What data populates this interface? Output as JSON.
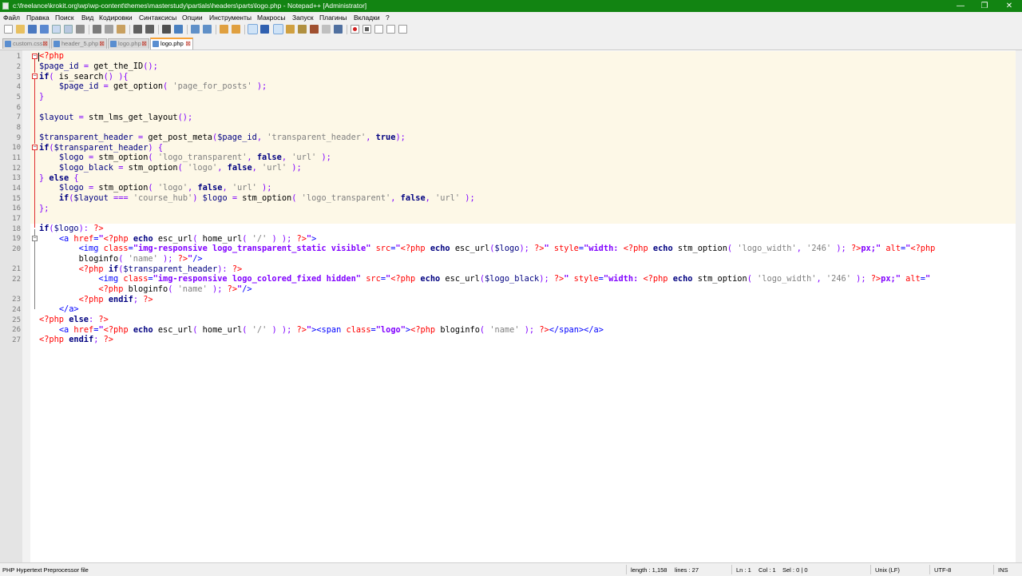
{
  "window": {
    "title": "c:\\freelance\\krokit.org\\wp\\wp-content\\themes\\masterstudy\\partials\\headers\\parts\\logo.php - Notepad++ [Administrator]",
    "minimize": "—",
    "maximize": "❐",
    "close": "✕"
  },
  "menu": [
    "Файл",
    "Правка",
    "Поиск",
    "Вид",
    "Кодировки",
    "Синтаксисы",
    "Опции",
    "Инструменты",
    "Макросы",
    "Запуск",
    "Плагины",
    "Вкладки",
    "?"
  ],
  "toolbar": [
    "new",
    "open",
    "save",
    "save-all",
    "close",
    "close-all",
    "print",
    "cut",
    "copy",
    "paste",
    "undo",
    "redo",
    "find",
    "replace",
    "zoom-in",
    "zoom-out",
    "sync-vertical",
    "sync-horizontal",
    "word-wrap",
    "show-all-chars",
    "indent-guide",
    "udl",
    "doc-map",
    "function-list",
    "folder-workspace",
    "monitor",
    "record-macro",
    "stop-record",
    "play-macro",
    "run-macro-multiple",
    "save-macro"
  ],
  "tabs": [
    {
      "label": "custom.css",
      "active": false
    },
    {
      "label": "header_5.php",
      "active": false
    },
    {
      "label": "logo.php",
      "active": false
    },
    {
      "label": "logo.php",
      "active": true
    }
  ],
  "code_lines": [
    "<?php",
    "$page_id = get_the_ID();",
    "if( is_search() ){",
    "    $page_id = get_option( 'page_for_posts' );",
    "}",
    "",
    "$layout = stm_lms_get_layout();",
    "",
    "$transparent_header = get_post_meta($page_id, 'transparent_header', true);",
    "if($transparent_header) {",
    "    $logo = stm_option( 'logo_transparent', false, 'url' );",
    "    $logo_black = stm_option( 'logo', false, 'url' );",
    "} else {",
    "    $logo = stm_option( 'logo', false, 'url' );",
    "    if($layout === 'course_hub') $logo = stm_option( 'logo_transparent', false, 'url' );",
    "};",
    "",
    "if($logo): ?>",
    "    <a href=\"<?php echo esc_url( home_url( '/' ) ); ?>\">",
    "        <img class=\"img-responsive logo_transparent_static visible\" src=\"<?php echo esc_url($logo); ?>\" style=\"width: <?php echo stm_option( 'logo_width', '246' ); ?>px;\" alt=\"<?php",
    "        bloginfo( 'name' ); ?>\"/>",
    "        <?php if($transparent_header): ?>",
    "            <img class=\"img-responsive logo_colored_fixed hidden\" src=\"<?php echo esc_url($logo_black); ?>\" style=\"width: <?php echo stm_option( 'logo_width', '246' ); ?>px;\" alt=\"",
    "            <?php bloginfo( 'name' ); ?>\"/>",
    "        <?php endif; ?>",
    "    </a>",
    "<?php else: ?>",
    "    <a href=\"<?php echo esc_url( home_url( '/' ) ); ?>\"><span class=\"logo\"><?php bloginfo( 'name' ); ?></span></a>",
    "<?php endif; ?>"
  ],
  "line_numbers": [
    "1",
    "2",
    "3",
    "4",
    "5",
    "6",
    "7",
    "8",
    "9",
    "10",
    "11",
    "12",
    "13",
    "14",
    "15",
    "16",
    "17",
    "18",
    "19",
    "20",
    "",
    "21",
    "22",
    "",
    "23",
    "24",
    "25",
    "26",
    "27"
  ],
  "status": {
    "language": "PHP Hypertext Preprocessor file",
    "length": "length : 1,158",
    "lines": "lines : 27",
    "ln": "Ln : 1",
    "col": "Col : 1",
    "sel": "Sel : 0 | 0",
    "eol": "Unix (LF)",
    "encoding": "UTF-8",
    "mode": "INS"
  },
  "colors": {
    "titlebar": "#128412",
    "current_block": "#fdf8e7",
    "keyword": "#000080",
    "string": "#808080",
    "php_tag": "#ff0000",
    "html_tag": "#0000ff"
  }
}
